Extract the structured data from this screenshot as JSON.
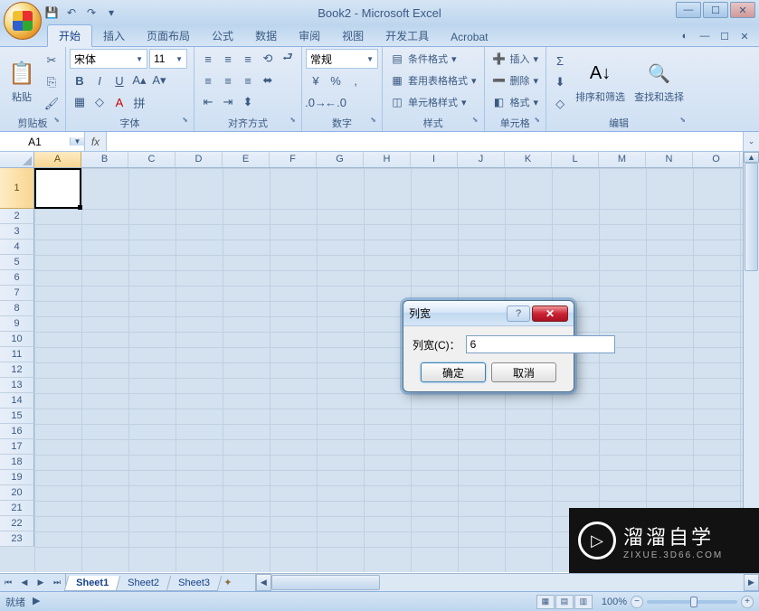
{
  "title": "Book2 - Microsoft Excel",
  "qat": {
    "save": "💾",
    "undo": "↶",
    "redo": "↷"
  },
  "tabs": [
    "开始",
    "插入",
    "页面布局",
    "公式",
    "数据",
    "审阅",
    "视图",
    "开发工具",
    "Acrobat"
  ],
  "active_tab_index": 0,
  "ribbon": {
    "clipboard": {
      "paste": "粘贴",
      "label": "剪贴板"
    },
    "font": {
      "name": "宋体",
      "size": "11",
      "bold": "B",
      "italic": "I",
      "underline": "U",
      "label": "字体"
    },
    "align": {
      "label": "对齐方式"
    },
    "number": {
      "format": "常规",
      "label": "数字"
    },
    "styles": {
      "cond": "条件格式",
      "table": "套用表格格式",
      "cell": "单元格样式",
      "label": "样式"
    },
    "cells": {
      "insert": "插入",
      "delete": "删除",
      "format": "格式",
      "label": "单元格"
    },
    "editing": {
      "sort": "排序和筛选",
      "find": "查找和选择",
      "label": "编辑"
    }
  },
  "name_box": "A1",
  "fx": "fx",
  "columns": [
    "A",
    "B",
    "C",
    "D",
    "E",
    "F",
    "G",
    "H",
    "I",
    "J",
    "K",
    "L",
    "M",
    "N",
    "O"
  ],
  "rows": [
    "1",
    "2",
    "3",
    "4",
    "5",
    "6",
    "7",
    "8",
    "9",
    "10",
    "11",
    "12",
    "13",
    "14",
    "15",
    "16",
    "17",
    "18",
    "19",
    "20",
    "21",
    "22",
    "23"
  ],
  "sheets": [
    "Sheet1",
    "Sheet2",
    "Sheet3"
  ],
  "active_sheet_index": 0,
  "status": "就绪",
  "zoom": "100%",
  "dialog": {
    "title": "列宽",
    "label": "列宽(C)：",
    "value": "6",
    "ok": "确定",
    "cancel": "取消"
  },
  "watermark": {
    "main": "溜溜自学",
    "sub": "ZIXUE.3D66.COM"
  }
}
